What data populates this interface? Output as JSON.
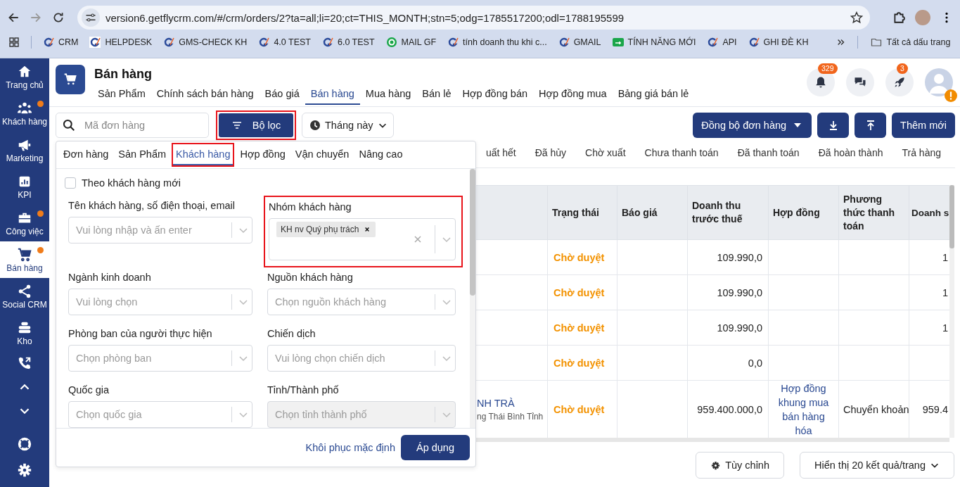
{
  "browser": {
    "url": "version6.getflycrm.com/#/crm/orders/2?ta=all;li=20;ct=THIS_MONTH;stn=5;odg=1785517200;odl=1788195599",
    "bookmarks": [
      {
        "label": "CRM",
        "kind": "g"
      },
      {
        "label": "HELPDESK",
        "kind": "g-boxed"
      },
      {
        "label": "GMS-CHECK KH",
        "kind": "g"
      },
      {
        "label": "4.0 TEST",
        "kind": "g"
      },
      {
        "label": "6.0 TEST",
        "kind": "g"
      },
      {
        "label": "MAIL GF",
        "kind": "target"
      },
      {
        "label": "tính doanh thu khi c...",
        "kind": "g"
      },
      {
        "label": "GMAIL",
        "kind": "g"
      },
      {
        "label": "TÍNH NĂNG MỚI",
        "kind": "green"
      },
      {
        "label": "API",
        "kind": "g"
      },
      {
        "label": "GHI ĐÈ KH",
        "kind": "g"
      }
    ],
    "all_bookmarks": "Tất cả dấu trang"
  },
  "sidebar": [
    {
      "label": "Trang chủ",
      "kind": "home",
      "dot": false,
      "selected": false
    },
    {
      "label": "Khách hàng",
      "kind": "people",
      "dot": true,
      "selected": false
    },
    {
      "label": "Marketing",
      "kind": "megaphone",
      "dot": false,
      "selected": false
    },
    {
      "label": "KPI",
      "kind": "chart",
      "dot": false,
      "selected": false
    },
    {
      "label": "Công việc",
      "kind": "briefcase",
      "dot": true,
      "selected": false
    },
    {
      "label": "Bán hàng",
      "kind": "cart",
      "dot": true,
      "selected": true
    },
    {
      "label": "Social CRM",
      "kind": "share",
      "dot": false,
      "selected": false
    },
    {
      "label": "Kho",
      "kind": "stack",
      "dot": false,
      "selected": false
    },
    {
      "kind": "phone",
      "dot": false,
      "selected": false
    },
    {
      "kind": "up",
      "dot": false,
      "selected": false
    },
    {
      "kind": "down",
      "dot": false,
      "selected": false
    },
    {
      "kind": "lifebuoy",
      "dot": false,
      "selected": false
    },
    {
      "kind": "gear",
      "dot": false,
      "selected": false
    }
  ],
  "header": {
    "title": "Bán hàng",
    "nav": [
      {
        "label": "Sản Phẩm",
        "selected": false
      },
      {
        "label": "Chính sách bán hàng",
        "selected": false
      },
      {
        "label": "Báo giá",
        "selected": false
      },
      {
        "label": "Bán hàng",
        "selected": true
      },
      {
        "label": "Mua hàng",
        "selected": false
      },
      {
        "label": "Bán lẻ",
        "selected": false
      },
      {
        "label": "Hợp đồng bán",
        "selected": false
      },
      {
        "label": "Hợp đồng mua",
        "selected": false
      },
      {
        "label": "Bảng giá bán lẻ",
        "selected": false
      }
    ],
    "notifications": "329",
    "rocket_badge": "3"
  },
  "toolbar": {
    "search_placeholder": "Mã đơn hàng",
    "filter_button": {
      "label": "Bộ lọc",
      "highlighted": true
    },
    "period": "Tháng này",
    "sync_button": "Đồng bộ đơn hàng",
    "add_button": "Thêm mới"
  },
  "status_tabs": [
    "uất hết",
    "Đã hủy",
    "Chờ xuất",
    "Chưa thanh toán",
    "Đã thanh toán",
    "Đã hoàn thành",
    "Trả hàng"
  ],
  "table": {
    "columns": [
      "Trạng thái",
      "Báo giá",
      "Doanh thu trước thuế",
      "Hợp đồng",
      "Phương thức thanh toán",
      "Doanh s"
    ],
    "rows": [
      {
        "customer": "",
        "customer_sub": "",
        "status": "Chờ duyệt",
        "revenue": "109.990,0",
        "contract": "",
        "payment": "",
        "column_7": "1"
      },
      {
        "customer": "",
        "customer_sub": "",
        "status": "Chờ duyệt",
        "revenue": "109.990,0",
        "contract": "",
        "payment": "",
        "column_7": "1"
      },
      {
        "customer": "",
        "customer_sub": "",
        "status": "Chờ duyệt",
        "revenue": "109.990,0",
        "contract": "",
        "payment": "",
        "column_7": "1"
      },
      {
        "customer": "",
        "customer_sub": "",
        "status": "Chờ duyệt",
        "revenue": "0,0",
        "contract": "",
        "payment": "",
        "column_7": ""
      },
      {
        "customer": "NH TRÀ",
        "customer_sub": "ng Thái Bình Tỉnh",
        "status": "Chờ duyệt",
        "revenue": "959.400.000,0",
        "contract": "Hợp đồng khung mua bán hàng hóa",
        "payment": "Chuyển khoản",
        "column_7": "959.4"
      }
    ]
  },
  "footer": {
    "customize": "Tùy chỉnh",
    "page_size": "Hiển thị 20 kết quả/trang"
  },
  "filter_panel": {
    "tabs": [
      {
        "label": "Đơn hàng",
        "selected": false,
        "highlighted": false
      },
      {
        "label": "Sản Phẩm",
        "selected": false,
        "highlighted": false
      },
      {
        "label": "Khách hàng",
        "selected": true,
        "highlighted": true
      },
      {
        "label": "Hợp đồng",
        "selected": false,
        "highlighted": false
      },
      {
        "label": "Vận chuyển",
        "selected": false,
        "highlighted": false
      },
      {
        "label": "Nâng cao",
        "selected": false,
        "highlighted": false
      }
    ],
    "new_customer": {
      "label": "Theo khách hàng mới",
      "checked": false
    },
    "fields": [
      {
        "label": "Tên khách hàng, số điện thoại, email",
        "placeholder": "Vui lòng nhập và ấn enter",
        "disabled": false,
        "highlighted": false
      },
      {
        "label": "Nhóm khách hàng",
        "tags": [
          "KH nv Quý phụ trách"
        ],
        "disabled": false,
        "highlighted": true
      },
      {
        "label": "Ngành kinh doanh",
        "placeholder": "Vui lòng chọn",
        "disabled": false,
        "highlighted": false
      },
      {
        "label": "Nguồn khách hàng",
        "placeholder": "Chọn nguồn khách hàng",
        "disabled": false,
        "highlighted": false
      },
      {
        "label": "Phòng ban của người thực hiện",
        "placeholder": "Chọn phòng ban",
        "disabled": false,
        "highlighted": false
      },
      {
        "label": "Chiến dịch",
        "placeholder": "Vui lòng chọn chiến dịch",
        "disabled": false,
        "highlighted": false
      },
      {
        "label": "Quốc gia",
        "placeholder": "Chọn quốc gia",
        "disabled": false,
        "highlighted": false
      },
      {
        "label": "Tỉnh/Thành phố",
        "placeholder": "Chọn tỉnh thành phố",
        "disabled": true,
        "highlighted": false
      }
    ],
    "reset": "Khôi phục mặc định",
    "apply": "Áp dụng"
  }
}
